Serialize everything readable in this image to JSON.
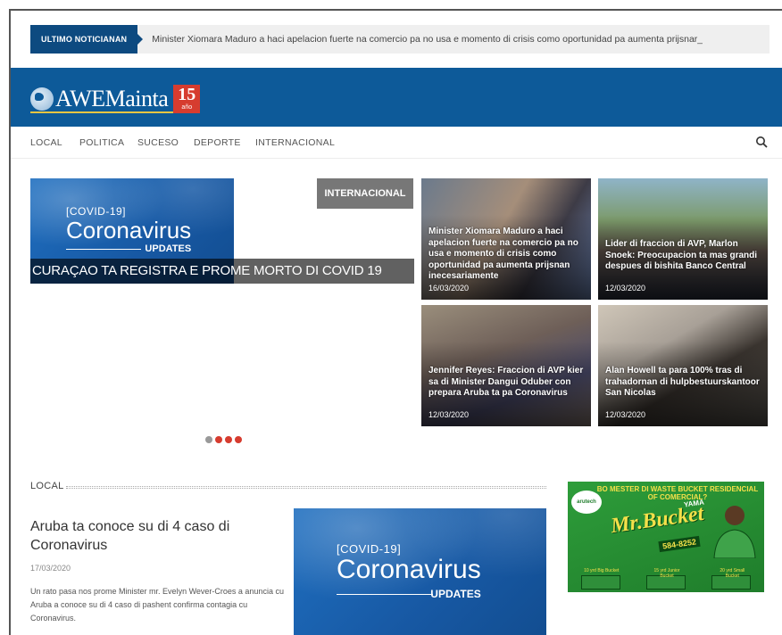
{
  "ticker": {
    "label": "ULTIMO NOTICIANAN",
    "text": "Minister Xiomara Maduro a haci apelacion fuerte na comercio pa no usa e momento di crisis como oportunidad pa aumenta prijsnar_"
  },
  "header": {
    "logo_text": "AWEMainta",
    "badge_number": "15",
    "badge_word": "año"
  },
  "nav": {
    "items": [
      "LOCAL",
      "POLITICA",
      "SUCESO",
      "DEPORTE",
      "INTERNACIONAL"
    ]
  },
  "hero": {
    "image_tag": "[COVID-19]",
    "image_big": "Coronavirus",
    "image_updates": "UPDATES",
    "caption": "CURAÇAO TA REGISTRA E PROME MORTO DI COVID 19",
    "category": "INTERNACIONAL"
  },
  "tiles": [
    {
      "title": "Minister Xiomara Maduro a haci apelacion fuerte na comercio pa no usa e momento di crisis como oportunidad pa aumenta prijsnan inecesariamente",
      "date": "16/03/2020"
    },
    {
      "title": "Lider di fraccion di AVP, Marlon Snoek: Preocupacion ta mas grandi despues di bishita Banco Central",
      "date": "12/03/2020"
    },
    {
      "title": "Jennifer Reyes: Fraccion di AVP kier sa di Minister Dangui Oduber con prepara Aruba ta pa Coronavirus",
      "date": "12/03/2020"
    },
    {
      "title": "Alan Howell ta para 100% tras di trahadornan di hulpbestuurskantoor San Nicolas",
      "date": "12/03/2020"
    }
  ],
  "section": {
    "title": "LOCAL"
  },
  "article": {
    "title": "Aruba ta conoce su di 4 caso di Coronavirus",
    "date": "17/03/2020",
    "excerpt": "Un rato pasa nos prome Minister mr. Evelyn Wever-Croes a anuncia cu Aruba a conoce su di 4 caso di pashent confirma contagia cu Coronavirus.",
    "image_tag": "[COVID-19]",
    "image_big": "Coronavirus",
    "image_updates": "UPDATES"
  },
  "ad": {
    "headline": "BO MESTER DI WASTE BUCKET RESIDENCIAL OF COMERCIAL?",
    "brand": "arutech",
    "yama": "YAMA",
    "main": "Mr.Bucket",
    "phone": "584-8252",
    "bins": [
      "10 yrd Big Bucket",
      "15 yrd Junior Bucket",
      "20 yrd Small Bucket"
    ]
  },
  "colors": {
    "brand_blue": "#0d5a99",
    "ticker_blue": "#0d4a80",
    "accent_red": "#d63c2f"
  }
}
